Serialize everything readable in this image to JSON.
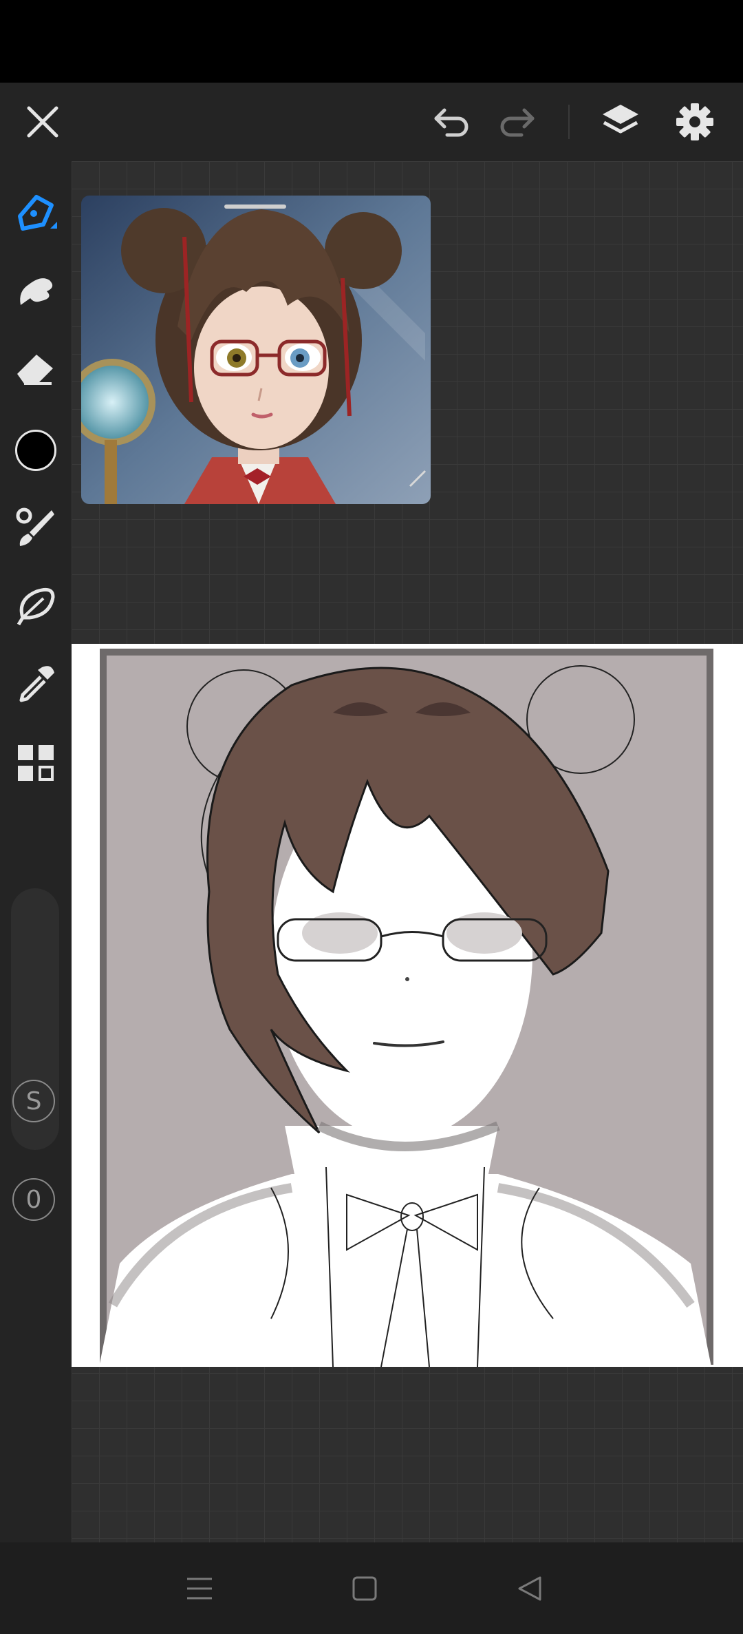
{
  "app": {
    "screen": "drawing-canvas"
  },
  "topbar": {
    "close_icon": "close-icon",
    "undo_icon": "undo-icon",
    "redo_icon": "redo-icon",
    "layers_icon": "layers-icon",
    "settings_icon": "gear-icon"
  },
  "toolbar": {
    "tools": [
      "pen",
      "smudge",
      "eraser",
      "color",
      "brush",
      "lasso",
      "eyedropper",
      "layouts"
    ],
    "active_tool": "pen",
    "current_color": "#000000",
    "size_label": "S",
    "opacity_label": "0"
  },
  "colors": {
    "accent": "#1e90ff",
    "toolbar_bg": "#242424",
    "canvas_bg": "#2f2f2f",
    "hair": "#6a5148"
  },
  "navbar": {
    "items": [
      "menu-icon",
      "home-icon",
      "back-icon"
    ]
  }
}
